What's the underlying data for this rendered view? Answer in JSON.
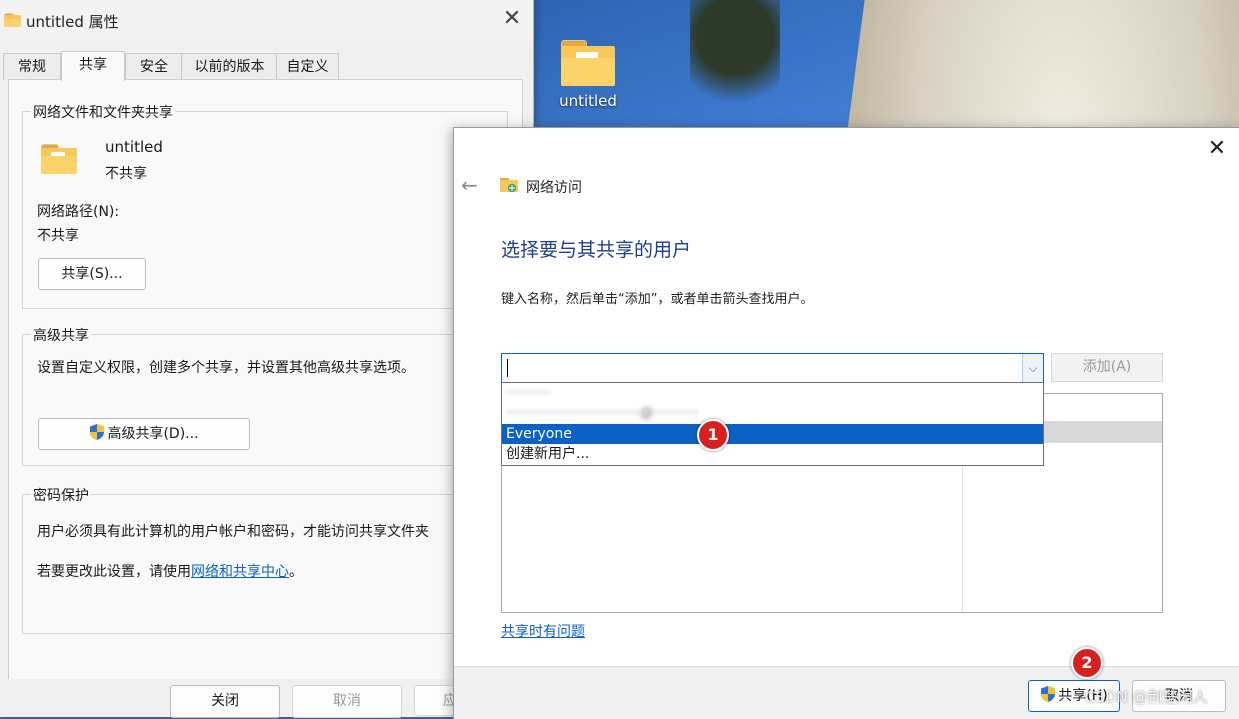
{
  "desktop": {
    "icon_label": "untitled"
  },
  "props_window": {
    "title": "untitled 属性",
    "tabs": [
      "常规",
      "共享",
      "安全",
      "以前的版本",
      "自定义"
    ],
    "active_tab": "共享",
    "network_sharing": {
      "group_title": "网络文件和文件夹共享",
      "folder_name": "untitled",
      "share_state": "不共享",
      "path_label": "网络路径(N):",
      "path_value": "不共享",
      "share_button": "共享(S)..."
    },
    "advanced_sharing": {
      "group_title": "高级共享",
      "description": "设置自定义权限，创建多个共享，并设置其他高级共享选项。",
      "button": "高级共享(D)..."
    },
    "password": {
      "group_title": "密码保护",
      "description": "用户必须具有此计算机的用户帐户和密码，才能访问共享文件夹",
      "change_prefix": "若要更改此设置，请使用",
      "change_link": "网络和共享中心",
      "change_suffix": "。"
    },
    "footer": {
      "close": "关闭",
      "cancel": "取消",
      "apply": "应"
    }
  },
  "network_dialog": {
    "title": "网络访问",
    "heading": "选择要与其共享的用户",
    "instruction": "键入名称，然后单击“添加”，或者单击箭头查找用户。",
    "input_value": "",
    "add_button": "添加(A)",
    "dropdown_items": [
      {
        "label": "··········",
        "state": "blurred"
      },
      {
        "label": "······························@··········",
        "state": "blurred"
      },
      {
        "label": "Everyone",
        "state": "highlighted"
      },
      {
        "label": "创建新用户...",
        "state": "normal"
      }
    ],
    "trouble_link": "共享时有问题",
    "share_button": "共享(H)",
    "cancel_button": "取消"
  },
  "annotations": {
    "badge_1": "1",
    "badge_2": "2"
  },
  "watermark": "CSDN @荆楚闲人"
}
